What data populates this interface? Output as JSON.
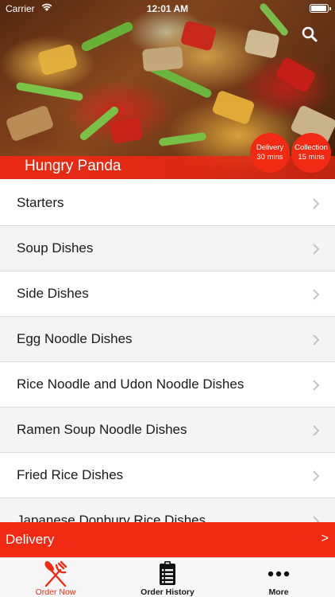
{
  "status_bar": {
    "carrier": "Carrier",
    "time": "12:01 AM"
  },
  "header": {
    "restaurant_name": "Hungry Panda",
    "delivery_badge": {
      "line1": "Delivery",
      "line2": "30 mins"
    },
    "collection_badge": {
      "line1": "Collection",
      "line2": "15 mins"
    },
    "search_icon": "search-icon"
  },
  "menu": {
    "items": [
      {
        "label": "Starters"
      },
      {
        "label": "Soup Dishes"
      },
      {
        "label": "Side Dishes"
      },
      {
        "label": "Egg Noodle Dishes"
      },
      {
        "label": "Rice Noodle and Udon Noodle Dishes"
      },
      {
        "label": "Ramen Soup Noodle Dishes"
      },
      {
        "label": "Fried Rice Dishes"
      },
      {
        "label": "Japanese Donbury Rice Dishes"
      }
    ]
  },
  "delivery_bar": {
    "label": "Delivery",
    "arrow": ">"
  },
  "tabs": [
    {
      "label": "Order Now",
      "icon": "fork-knife-icon",
      "active": true
    },
    {
      "label": "Order History",
      "icon": "clipboard-icon",
      "active": false
    },
    {
      "label": "More",
      "icon": "more-dots-icon",
      "active": false
    }
  ],
  "colors": {
    "accent": "#f22a14",
    "tab_inactive": "#1a1a1a",
    "list_alt_row": "#f4f4f4"
  }
}
